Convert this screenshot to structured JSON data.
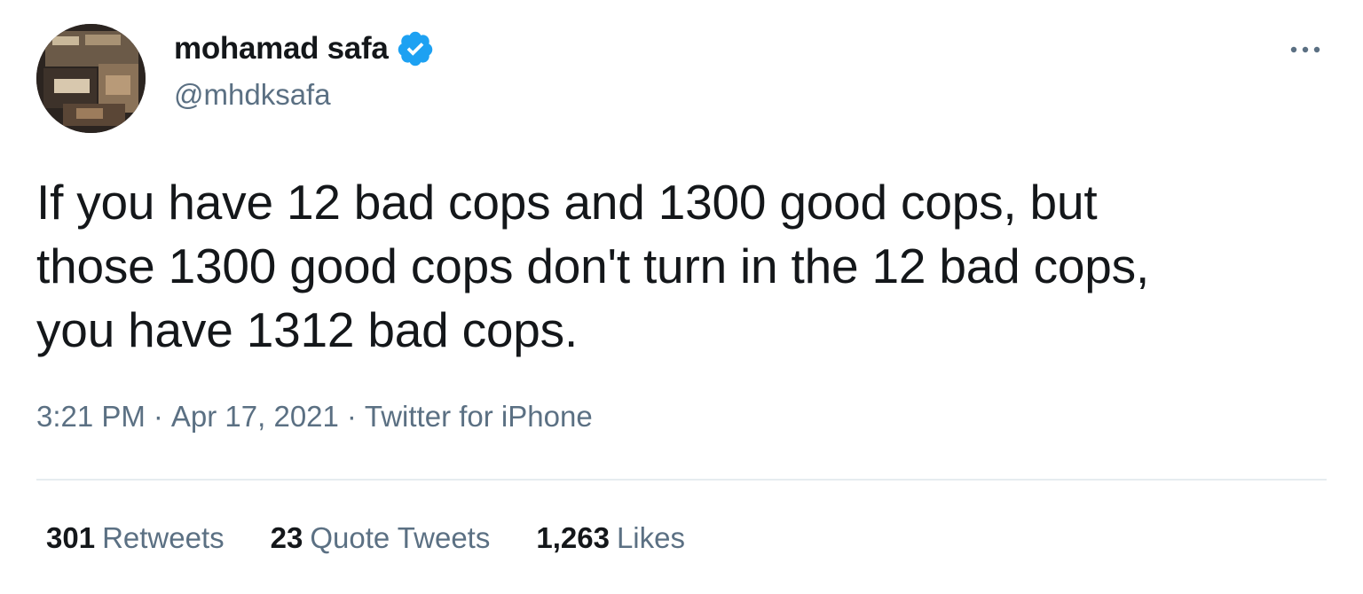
{
  "author": {
    "display_name": "mohamad safa",
    "handle": "@mhdksafa",
    "verified_icon": "verified-badge-icon",
    "verified_color": "#1da1f2"
  },
  "tweet": {
    "text": "If you have 12 bad cops and 1300 good cops, but\nthose 1300 good cops don't turn in the 12 bad cops,\nyou have 1312 bad cops."
  },
  "meta": {
    "time": "3:21 PM",
    "separator": "·",
    "date": "Apr 17, 2021",
    "source": "Twitter for iPhone"
  },
  "stats": {
    "retweets_count": "301",
    "retweets_label": "Retweets",
    "quotes_count": "23",
    "quotes_label": "Quote Tweets",
    "likes_count": "1,263",
    "likes_label": "Likes"
  },
  "colors": {
    "primary_text": "#14171a",
    "secondary_text": "#5b7083",
    "divider": "#e6ecf0"
  },
  "icons": {
    "more": "more-options-icon",
    "avatar": "avatar-photo"
  }
}
